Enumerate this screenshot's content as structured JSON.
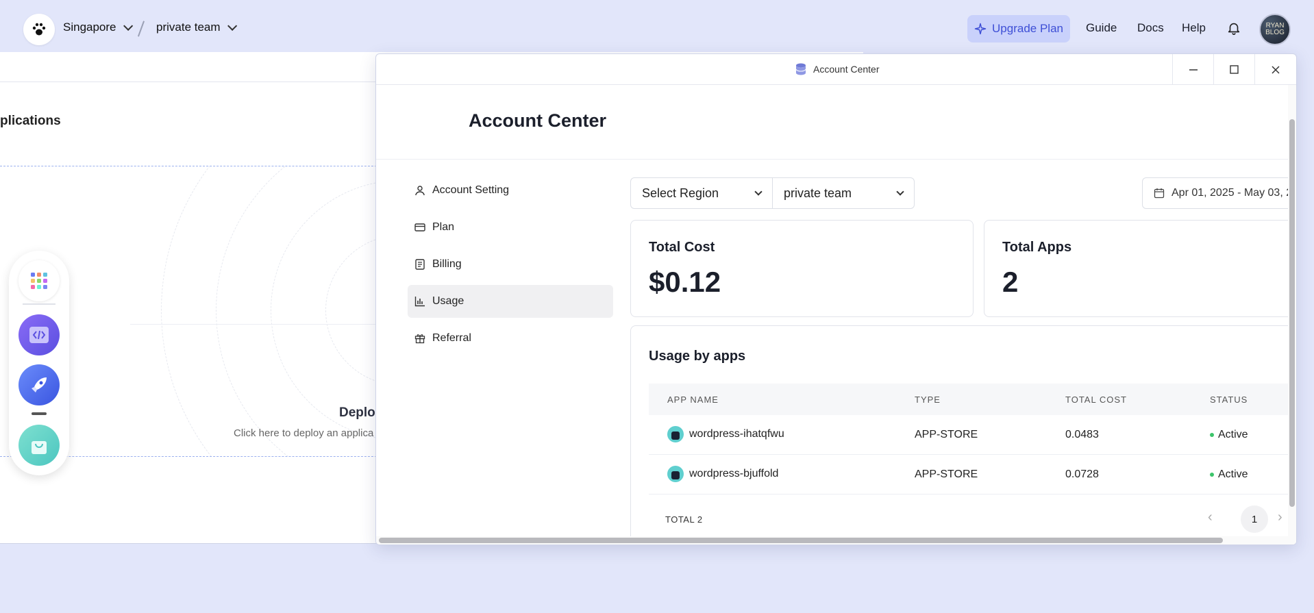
{
  "topbar": {
    "region": "Singapore",
    "team": "private team",
    "upgrade_label": "Upgrade Plan",
    "links": [
      "Guide",
      "Docs",
      "Help"
    ],
    "avatar_text_1": "RYAN",
    "avatar_text_2": "BLOG"
  },
  "background": {
    "page_title": "plications",
    "deploy_title": "Deplo",
    "deploy_subtitle": "Click here to deploy an applica"
  },
  "modal": {
    "window_title": "Account Center",
    "heading": "Account Center",
    "sidebar": [
      {
        "label": "Account Setting",
        "icon": "user-icon"
      },
      {
        "label": "Plan",
        "icon": "card-icon"
      },
      {
        "label": "Billing",
        "icon": "receipt-icon"
      },
      {
        "label": "Usage",
        "icon": "bar-chart-icon",
        "active": true
      },
      {
        "label": "Referral",
        "icon": "gift-icon"
      }
    ],
    "filters": {
      "region_placeholder": "Select Region",
      "team_value": "private team",
      "date_range": "Apr 01, 2025 - May 03, 2"
    },
    "cards": {
      "total_cost_label": "Total Cost",
      "total_cost_value": "$0.12",
      "total_apps_label": "Total Apps",
      "total_apps_value": "2"
    },
    "usage": {
      "title": "Usage by apps",
      "columns": [
        "APP NAME",
        "TYPE",
        "TOTAL COST",
        "STATUS"
      ],
      "rows": [
        {
          "name": "wordpress-ihatqfwu",
          "type": "APP-STORE",
          "cost": "0.0483",
          "status": "Active"
        },
        {
          "name": "wordpress-bjuffold",
          "type": "APP-STORE",
          "cost": "0.0728",
          "status": "Active"
        }
      ],
      "total": "TOTAL 2",
      "page": "1"
    }
  },
  "colors": {
    "accent": "#3e4fd6",
    "page_bg": "#e2e6fa",
    "status_active": "#3cc46a"
  }
}
